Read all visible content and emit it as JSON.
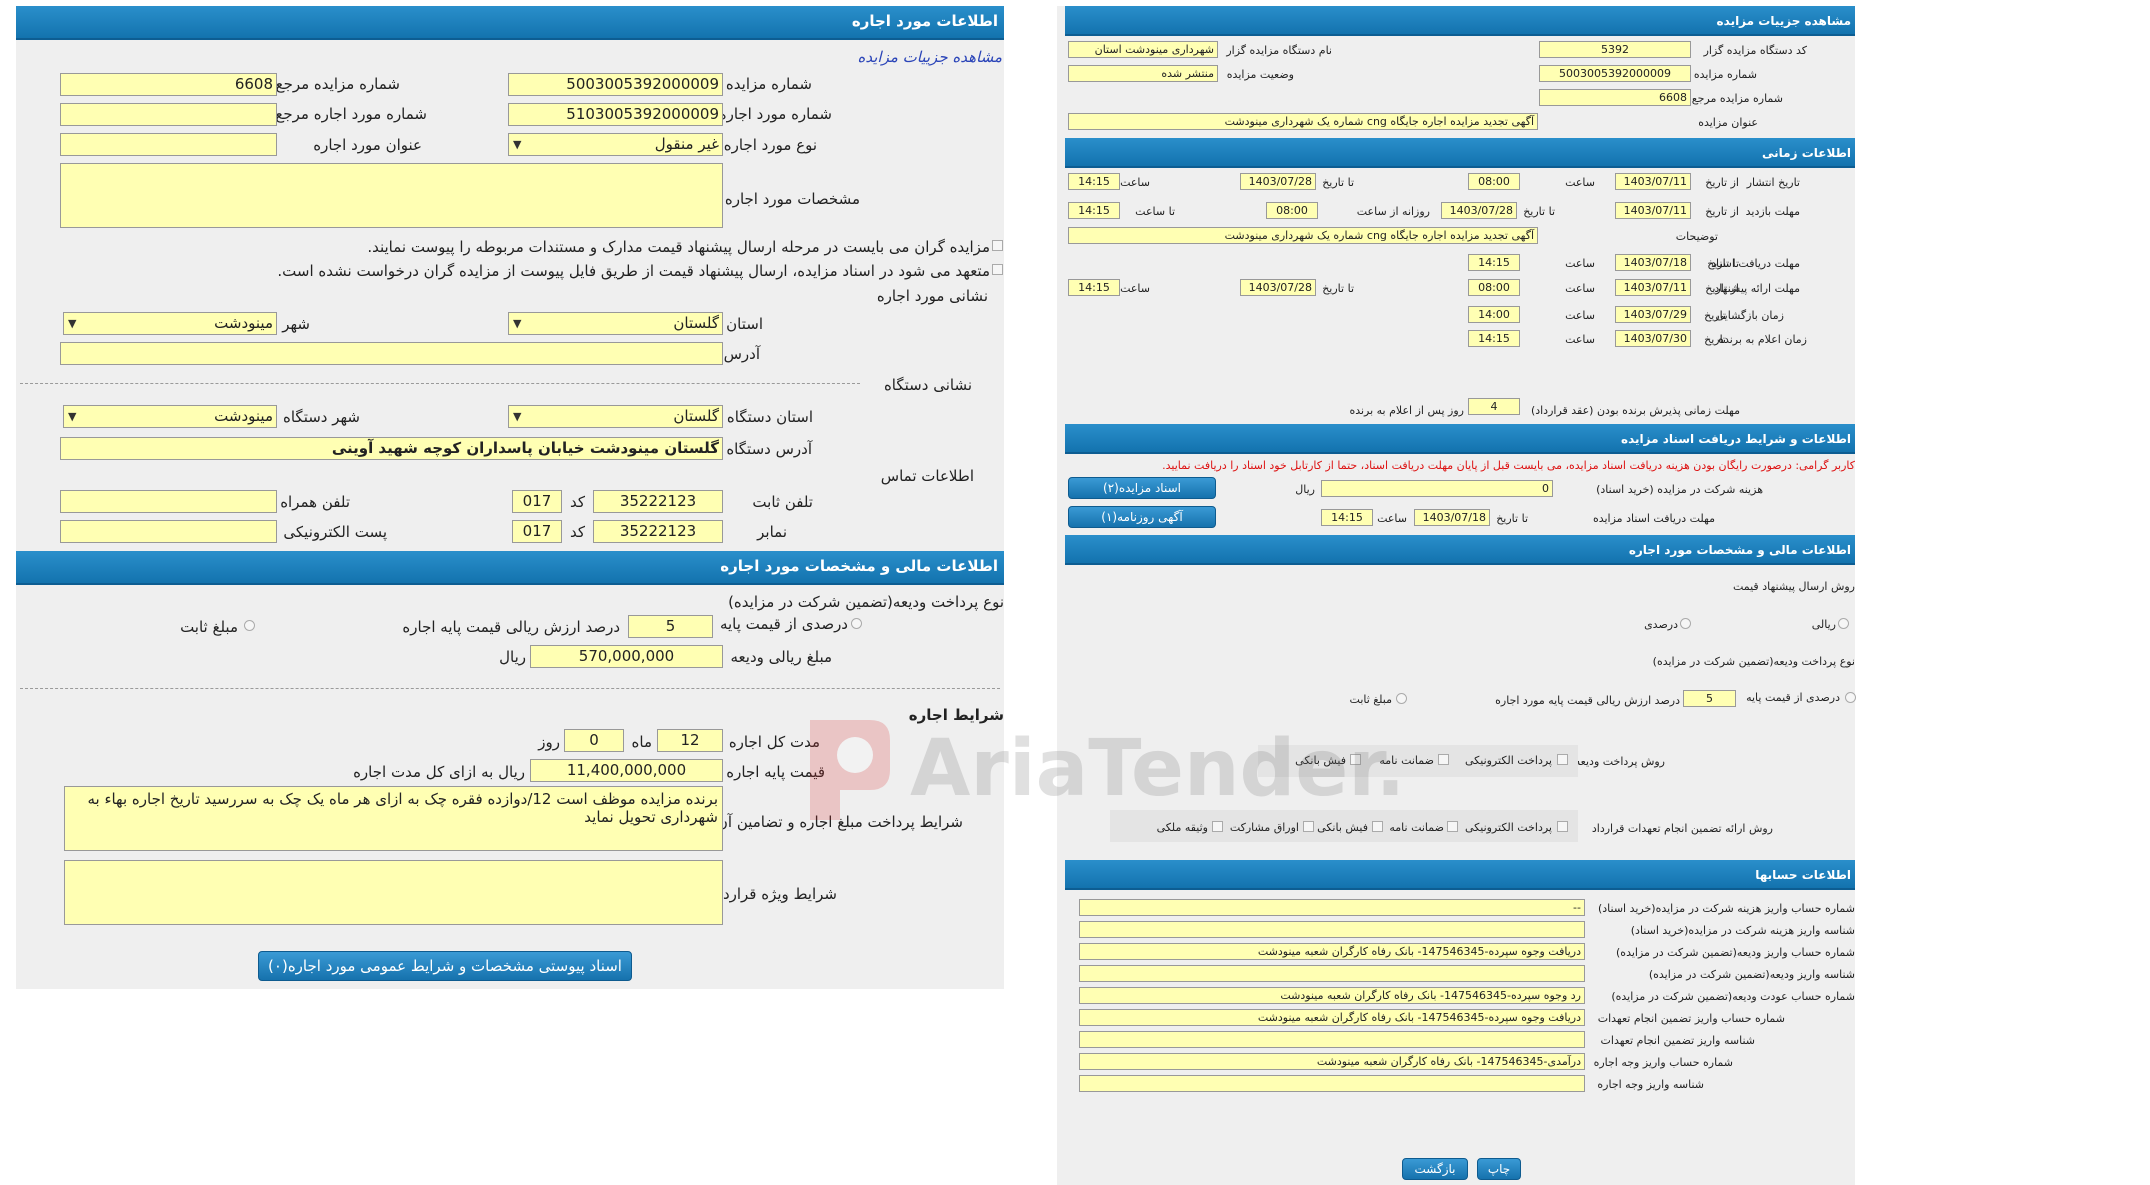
{
  "left": {
    "title": "اطلاعات مورد اجاره",
    "view_link": "مشاهده جزییات مزایده",
    "auction_number_label": "شماره مزایده",
    "auction_number": "5003005392000009",
    "ref_auction_number_label": "شماره مزایده مرجع",
    "ref_auction_number": "6608",
    "lease_item_number_label": "شماره مورد اجاره",
    "lease_item_number": "5103005392000009",
    "ref_lease_item_number_label": "شماره مورد اجاره مرجع",
    "ref_lease_item_number": "",
    "lease_type_label": "نوع مورد اجاره",
    "lease_type": "غیر منقول",
    "lease_title_label": "عنوان مورد اجاره",
    "lease_title": "",
    "lease_specs_label": "مشخصات مورد اجاره",
    "lease_specs": "",
    "check1": "مزایده گران می بایست در مرحله ارسال پیشنهاد قیمت مدارک و مستندات مربوطه را پیوست نمایند.",
    "check2": "متعهد می شود در اسناد مزایده، ارسال پیشنهاد قیمت از طریق فایل پیوست از مزایده گران درخواست نشده است.",
    "address_section": "نشانی مورد اجاره",
    "province_label": "استان",
    "province": "گلستان",
    "city_label": "شهر",
    "city": "مینودشت",
    "address_label": "آدرس",
    "address": "",
    "device_section": "نشانی دستگاه",
    "device_province_label": "استان دستگاه",
    "device_province": "گلستان",
    "device_city_label": "شهر دستگاه",
    "device_city": "مینودشت",
    "device_address_label": "آدرس دستگاه",
    "device_address": "گلستان مینودشت خیابان پاسداران کوچه شهید آوینی",
    "contact_section": "اطلاعات تماس",
    "phone_label": "تلفن ثابت",
    "phone": "35222123",
    "code_label": "کد",
    "phone_code": "017",
    "mobile_label": "تلفن همراه",
    "mobile": "",
    "fax_label": "نمابر",
    "fax": "35222123",
    "fax_code": "017",
    "email_label": "پست الکترونیکی",
    "email": "",
    "finance_title": "اطلاعات مالی و مشخصات مورد اجاره",
    "deposit_type_label": "نوع پرداخت ودیعه(تضمین شرکت در مزایده)",
    "percent_label": "درصدی از قیمت پایه",
    "percent_value": "5",
    "percent_desc": "درصد ارزش ریالی قیمت پایه اجاره",
    "fixed_label": "مبلغ ثابت",
    "deposit_amount_label": "مبلغ ریالی ودیعه",
    "deposit_amount": "570,000,000",
    "rial": "ریال",
    "lease_terms_title": "شرایط اجاره",
    "duration_label": "مدت کل اجاره",
    "duration_months": "12",
    "month_label": "ماه",
    "duration_days": "0",
    "day_label": "روز",
    "base_price_label": "قیمت پایه اجاره",
    "base_price": "11,400,000,000",
    "base_price_unit": "ریال به ازای کل مدت اجاره",
    "payment_terms_label": "شرایط پرداخت مبلغ اجاره و تضامین آن",
    "payment_terms": "برنده مزایده موظف است 12/دوازده فقره چک به ازای هر ماه یک چک به سررسید تاریخ اجاره بهاء به شهرداری تحویل نماید",
    "special_terms_label": "شرایط ویژه قرارداد",
    "special_terms": "",
    "attach_button": "اسناد پیوستی مشخصات و شرایط عمومی مورد اجاره(۰)"
  },
  "right": {
    "title": "مشاهده جزییات مزایده",
    "org_code_label": "کد دستگاه مزایده گزار",
    "org_code": "5392",
    "org_name_label": "نام دستگاه مزایده گزار",
    "org_name": "شهرداری مینودشت استان",
    "auction_no_label": "شماره مزایده",
    "auction_no": "5003005392000009",
    "status_label": "وضعیت مزایده",
    "status": "منتشر شده",
    "ref_no_label": "شماره مزایده مرجع",
    "ref_no": "6608",
    "subject_label": "عنوان مزایده",
    "subject": "آگهی  تجدید مزایده اجاره جایگاه cng شماره یک شهرداری مینودشت",
    "time_title": "اطلاعات زمانی",
    "publish_label": "تاریخ انتشار",
    "from_date": "از تاریخ",
    "to_date": "تا تاریخ",
    "hour": "ساعت",
    "publish_from": "1403/07/11",
    "publish_from_time": "08:00",
    "publish_to": "1403/07/28",
    "publish_to_time": "14:15",
    "visit_label": "مهلت بازدید",
    "visit_from": "1403/07/11",
    "visit_to": "1403/07/28",
    "daily_from": "روزانه از ساعت",
    "visit_daily_from": "08:00",
    "until_hour": "تا ساعت",
    "visit_daily_to": "14:15",
    "desc_label": "توضیحات",
    "desc": "آگهی  تجدید مزایده اجاره جایگاه cng شماره یک شهرداری مینودشت",
    "docs_receive_label": "مهلت دریافت اسناد",
    "docs_to": "1403/07/18",
    "docs_time": "14:15",
    "offer_label": "مهلت ارائه پیشنهاد",
    "offer_from": "1403/07/11",
    "offer_from_time": "08:00",
    "offer_to": "1403/07/28",
    "offer_to_time": "14:15",
    "opening_label": "زمان بازگشایی",
    "date": "تاریخ",
    "opening_date": "1403/07/29",
    "opening_time": "14:00",
    "winner_label": "زمان اعلام به برنده",
    "winner_date": "1403/07/30",
    "winner_time": "14:15",
    "acceptance_label": "مهلت زمانی پذیرش برنده بودن (عقد قرارداد)",
    "acceptance_days": "4",
    "acceptance_suffix": "روز پس از اعلام به برنده",
    "docs_title": "اطلاعات و شرایط دریافت اسناد مزایده",
    "notice": "کاربر گرامی: درصورت رایگان بودن هزینه دریافت اسناد مزایده، می بایست قبل از پایان مهلت دریافت اسناد، حتما از کارتابل خود اسناد را دریافت نمایید.",
    "fee_label": "هزینه شرکت در مزایده (خرید اسناد)",
    "fee": "0",
    "rial": "ریال",
    "docs_button": "اسناد مزایده(۲)",
    "docs_deadline_label": "مهلت دریافت اسناد مزایده",
    "docs_deadline": "1403/07/18",
    "docs_deadline_time": "14:15",
    "newspaper_button": "آگهی روزنامه(۱)",
    "finance_title": "اطلاعات مالی و مشخصات مورد اجاره",
    "offer_method_label": "روش ارسال پیشنهاد قیمت",
    "rial_option": "ریالی",
    "percent_option": "درصدی",
    "deposit_type_label": "نوع پرداخت ودیعه(تضمین شرکت در مزایده)",
    "percent_base_label": "درصدی از قیمت پایه",
    "percent_value": "5",
    "percent_desc": "درصد ارزش ریالی قیمت پایه مورد اجاره",
    "fixed_label": "مبلغ ثابت",
    "deposit_pay_label": "روش پرداخت ودیعه(تضمین شرکت در مزایده)",
    "opt_electronic": "پرداخت الکترونیکی",
    "opt_guarantee": "ضمانت نامه",
    "opt_bank_receipt": "فیش بانکی",
    "guarantee_method_label": "روش ارائه تضمین انجام تعهدات قرارداد",
    "opt_bonds": "اوراق مشارکت",
    "opt_property": "وثیقه ملکی",
    "accounts_title": "اطلاعات حسابها",
    "accounts": [
      {
        "label": "شماره حساب واریز هزینه شرکت در مزایده(خرید اسناد)",
        "value": "--"
      },
      {
        "label": "شناسه واریز هزینه شرکت در مزایده(خرید اسناد)",
        "value": ""
      },
      {
        "label": "شماره حساب واریز ودیعه(تضمین شرکت در مزایده)",
        "value": "دریافت وجوه سپرده-147546345- بانک رفاه کارگران شعبه مینودشت"
      },
      {
        "label": "شناسه واریز ودیعه(تضمین شرکت در مزایده)",
        "value": ""
      },
      {
        "label": "شماره حساب عودت ودیعه(تضمین شرکت در مزایده)",
        "value": "رد وجوه سپرده-147546345- بانک رفاه کارگران شعبه مینودشت"
      },
      {
        "label": "شماره حساب واریز تضمین انجام تعهدات",
        "value": "دریافت وجوه سپرده-147546345- بانک رفاه کارگران شعبه مینودشت"
      },
      {
        "label": "شناسه واریز تضمین انجام تعهدات",
        "value": ""
      },
      {
        "label": "شماره حساب واریز وجه اجاره",
        "value": "درآمدی-147546345- بانک رفاه کارگران شعبه مینودشت"
      },
      {
        "label": "شناسه واریز وجه اجاره",
        "value": ""
      }
    ],
    "print_button": "چاپ",
    "back_button": "بازگشت"
  },
  "watermark": "AriaTender.neT",
  "colors": {
    "band": "#1a7ec0",
    "field": "#ffffb3",
    "panel": "#efefef",
    "notice": "#d11111"
  }
}
